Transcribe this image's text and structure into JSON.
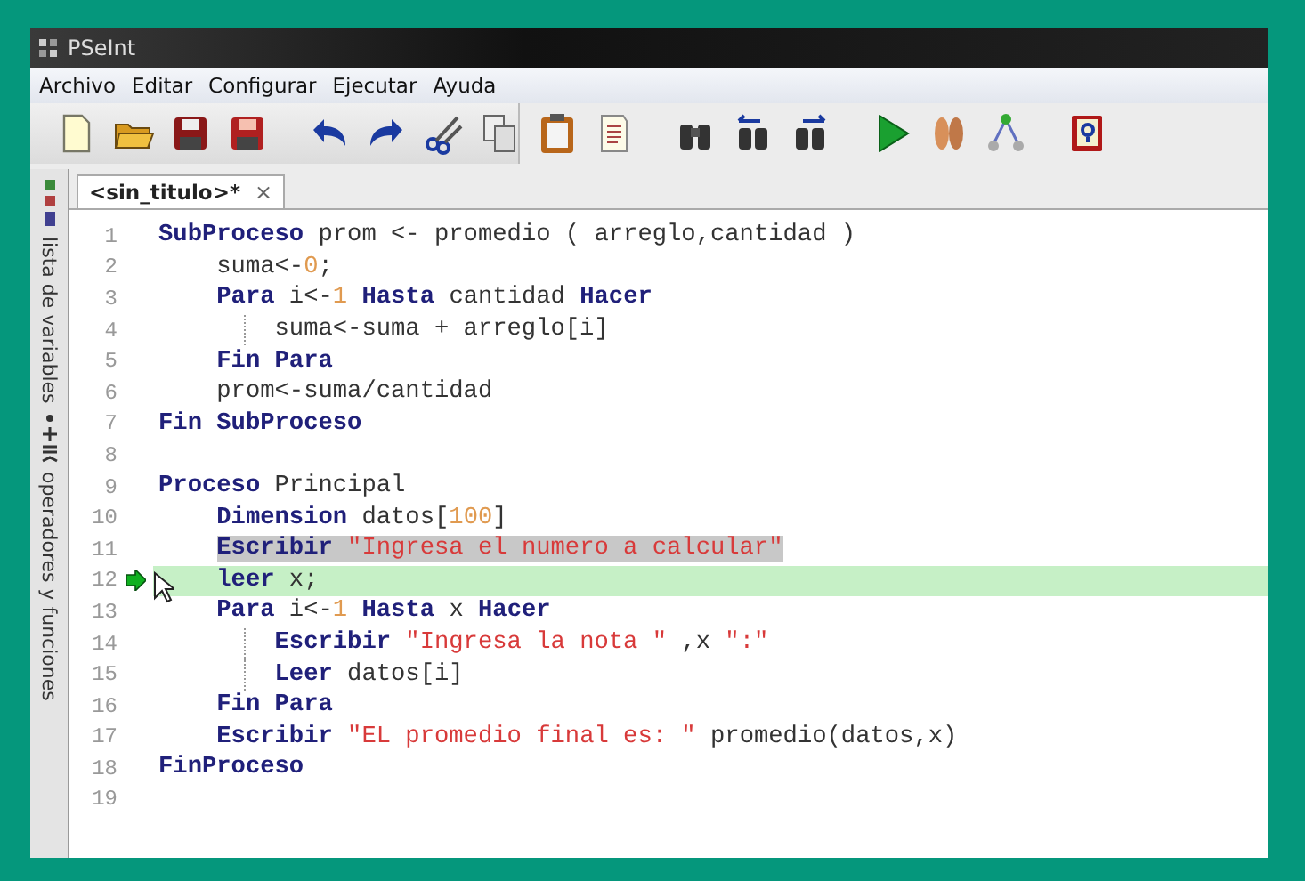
{
  "window": {
    "title": "PSeInt"
  },
  "menu": [
    "Archivo",
    "Editar",
    "Configurar",
    "Ejecutar",
    "Ayuda"
  ],
  "tabs": [
    {
      "label": "<sin_titulo>*",
      "close": "×",
      "selected": true
    }
  ],
  "side_panels": [
    {
      "label": "lista de variables"
    },
    {
      "label": "operadores y funciones"
    }
  ],
  "code": {
    "lines": [
      {
        "number": "1",
        "selected": false,
        "current": false,
        "guide": false,
        "tokens": [
          {
            "kind": "keyword",
            "text": "SubProceso"
          },
          {
            "kind": "plain",
            "text": " prom <- promedio ( arreglo,cantidad )"
          }
        ],
        "children": [
          {
            "number": "2",
            "selected": false,
            "current": false,
            "tokens": [
              {
                "kind": "plain",
                "text": "suma<-"
              },
              {
                "kind": "number",
                "text": "0"
              },
              {
                "kind": "plain",
                "text": ";"
              }
            ]
          },
          {
            "number": "3",
            "selected": false,
            "current": false,
            "guide": true,
            "tokens": [
              {
                "kind": "keyword",
                "text": "Para"
              },
              {
                "kind": "plain",
                "text": " i<-"
              },
              {
                "kind": "number",
                "text": "1"
              },
              {
                "kind": "keyword",
                "text": " Hasta"
              },
              {
                "kind": "plain",
                "text": " cantidad"
              },
              {
                "kind": "keyword",
                "text": " Hacer"
              }
            ],
            "children": [
              {
                "number": "4",
                "selected": false,
                "current": false,
                "tokens": [
                  {
                    "kind": "plain",
                    "text": "suma<-suma + arreglo[i]"
                  }
                ]
              }
            ]
          },
          {
            "number": "5",
            "selected": false,
            "current": false,
            "tokens": [
              {
                "kind": "keyword",
                "text": "Fin Para"
              }
            ]
          },
          {
            "number": "6",
            "selected": false,
            "current": false,
            "tokens": [
              {
                "kind": "plain",
                "text": "prom<-suma/cantidad"
              }
            ]
          }
        ]
      },
      {
        "number": "7",
        "selected": false,
        "current": false,
        "tokens": [
          {
            "kind": "keyword",
            "text": "Fin SubProceso"
          }
        ]
      },
      {
        "number": "8",
        "selected": false,
        "current": false
      },
      {
        "number": "9",
        "selected": false,
        "current": false,
        "guide": false,
        "tokens": [
          {
            "kind": "keyword",
            "text": "Proceso"
          },
          {
            "kind": "plain",
            "text": " Principal"
          }
        ],
        "children": [
          {
            "number": "10",
            "selected": false,
            "current": false,
            "tokens": [
              {
                "kind": "keyword",
                "text": "Dimension"
              },
              {
                "kind": "plain",
                "text": " datos["
              },
              {
                "kind": "number",
                "text": "100"
              },
              {
                "kind": "plain",
                "text": "]"
              }
            ]
          },
          {
            "number": "11",
            "selected": true,
            "current": false,
            "tokens": [
              {
                "kind": "keyword",
                "text": "Escribir"
              },
              {
                "kind": "string",
                "text": " \"Ingresa el numero a calcular\""
              }
            ]
          },
          {
            "number": "12",
            "selected": false,
            "current": true,
            "tokens": [
              {
                "kind": "keyword",
                "text": "leer"
              },
              {
                "kind": "plain",
                "text": " x;"
              }
            ]
          },
          {
            "number": "13",
            "selected": false,
            "current": false,
            "guide": true,
            "tokens": [
              {
                "kind": "keyword",
                "text": "Para"
              },
              {
                "kind": "plain",
                "text": " i<-"
              },
              {
                "kind": "number",
                "text": "1"
              },
              {
                "kind": "keyword",
                "text": " Hasta"
              },
              {
                "kind": "plain",
                "text": " x"
              },
              {
                "kind": "keyword",
                "text": " Hacer"
              }
            ],
            "children": [
              {
                "number": "14",
                "selected": false,
                "current": false,
                "tokens": [
                  {
                    "kind": "keyword",
                    "text": "Escribir"
                  },
                  {
                    "kind": "string",
                    "text": " \"Ingresa la nota \""
                  },
                  {
                    "kind": "plain",
                    "text": " ,x"
                  },
                  {
                    "kind": "string",
                    "text": " \":\""
                  }
                ]
              },
              {
                "number": "15",
                "selected": false,
                "current": false,
                "tokens": [
                  {
                    "kind": "keyword",
                    "text": "Leer"
                  },
                  {
                    "kind": "plain",
                    "text": " datos[i]"
                  }
                ]
              }
            ]
          },
          {
            "number": "16",
            "selected": false,
            "current": false,
            "tokens": [
              {
                "kind": "keyword",
                "text": "Fin Para"
              }
            ]
          },
          {
            "number": "17",
            "selected": false,
            "current": false,
            "tokens": [
              {
                "kind": "keyword",
                "text": "Escribir"
              },
              {
                "kind": "string",
                "text": " \"EL promedio final es: \""
              },
              {
                "kind": "plain",
                "text": " promedio(datos,x)"
              }
            ]
          }
        ]
      },
      {
        "number": "18",
        "selected": false,
        "current": false,
        "tokens": [
          {
            "kind": "keyword",
            "text": "FinProceso"
          }
        ]
      },
      {
        "number": "19",
        "selected": false,
        "current": false
      }
    ]
  }
}
